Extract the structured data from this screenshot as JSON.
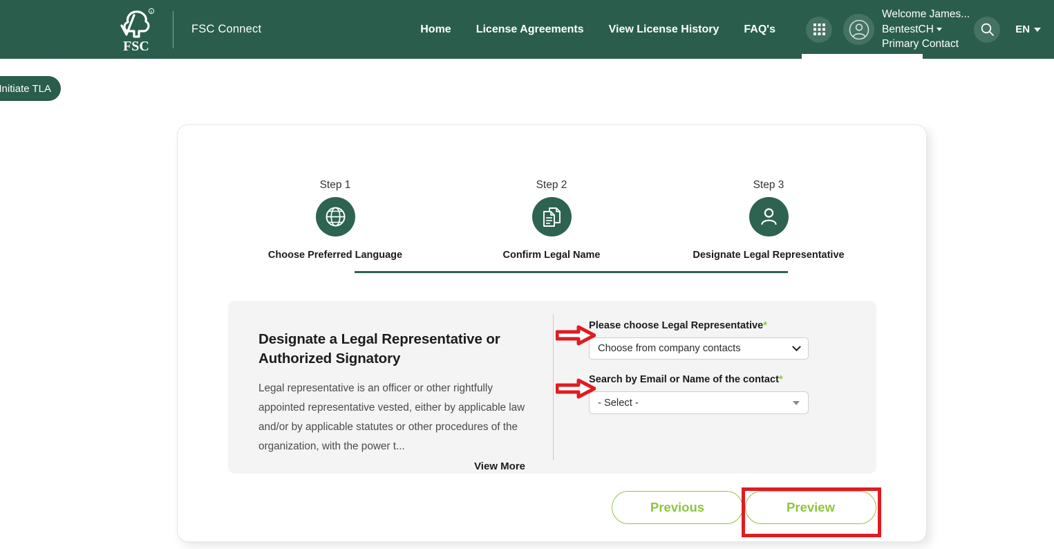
{
  "header": {
    "brand_name": "FSC Connect",
    "logo_icon": "fsc-tree-logo",
    "nav": [
      {
        "label": "Home"
      },
      {
        "label": "License Agreements"
      },
      {
        "label": "View License History"
      },
      {
        "label": "FAQ's"
      }
    ],
    "apps_icon": "grid-apps-icon",
    "avatar_icon": "user-avatar-icon",
    "search_icon": "search-icon",
    "user": {
      "welcome": "Welcome James...",
      "company": "BentestCH",
      "role": "Primary Contact"
    },
    "language": {
      "code": "EN",
      "caret_icon": "chevron-down-icon"
    },
    "bg_color": "#2a5d4c"
  },
  "side_tab": {
    "label": "Initiate TLA"
  },
  "stepper": {
    "steps": [
      {
        "label": "Step 1",
        "title": "Choose Preferred Language",
        "icon": "globe-icon"
      },
      {
        "label": "Step 2",
        "title": "Confirm Legal Name",
        "icon": "documents-icon"
      },
      {
        "label": "Step 3",
        "title": "Designate Legal Representative",
        "icon": "person-icon"
      }
    ],
    "circle_color": "#2d6350"
  },
  "panel": {
    "heading": "Designate a Legal Representative or Authorized Signatory",
    "body": "Legal representative is an officer or other rightfully appointed representative vested, either by applicable law and/or by applicable statutes or other procedures of the organization, with the power t...",
    "view_more": "View More",
    "fields": [
      {
        "label": "Please choose Legal Representative",
        "required_marker": "*",
        "value": "Choose from company contacts",
        "arrow_icon": "chevron-down-icon"
      },
      {
        "label": "Search by Email or Name of the contact",
        "required_marker": "*",
        "value": "- Select -",
        "arrow_icon": "triangle-down-icon"
      }
    ]
  },
  "buttons": {
    "previous": "Previous",
    "preview": "Preview",
    "accent_color": "#8dc63f",
    "highlight_color": "#e01b22"
  }
}
